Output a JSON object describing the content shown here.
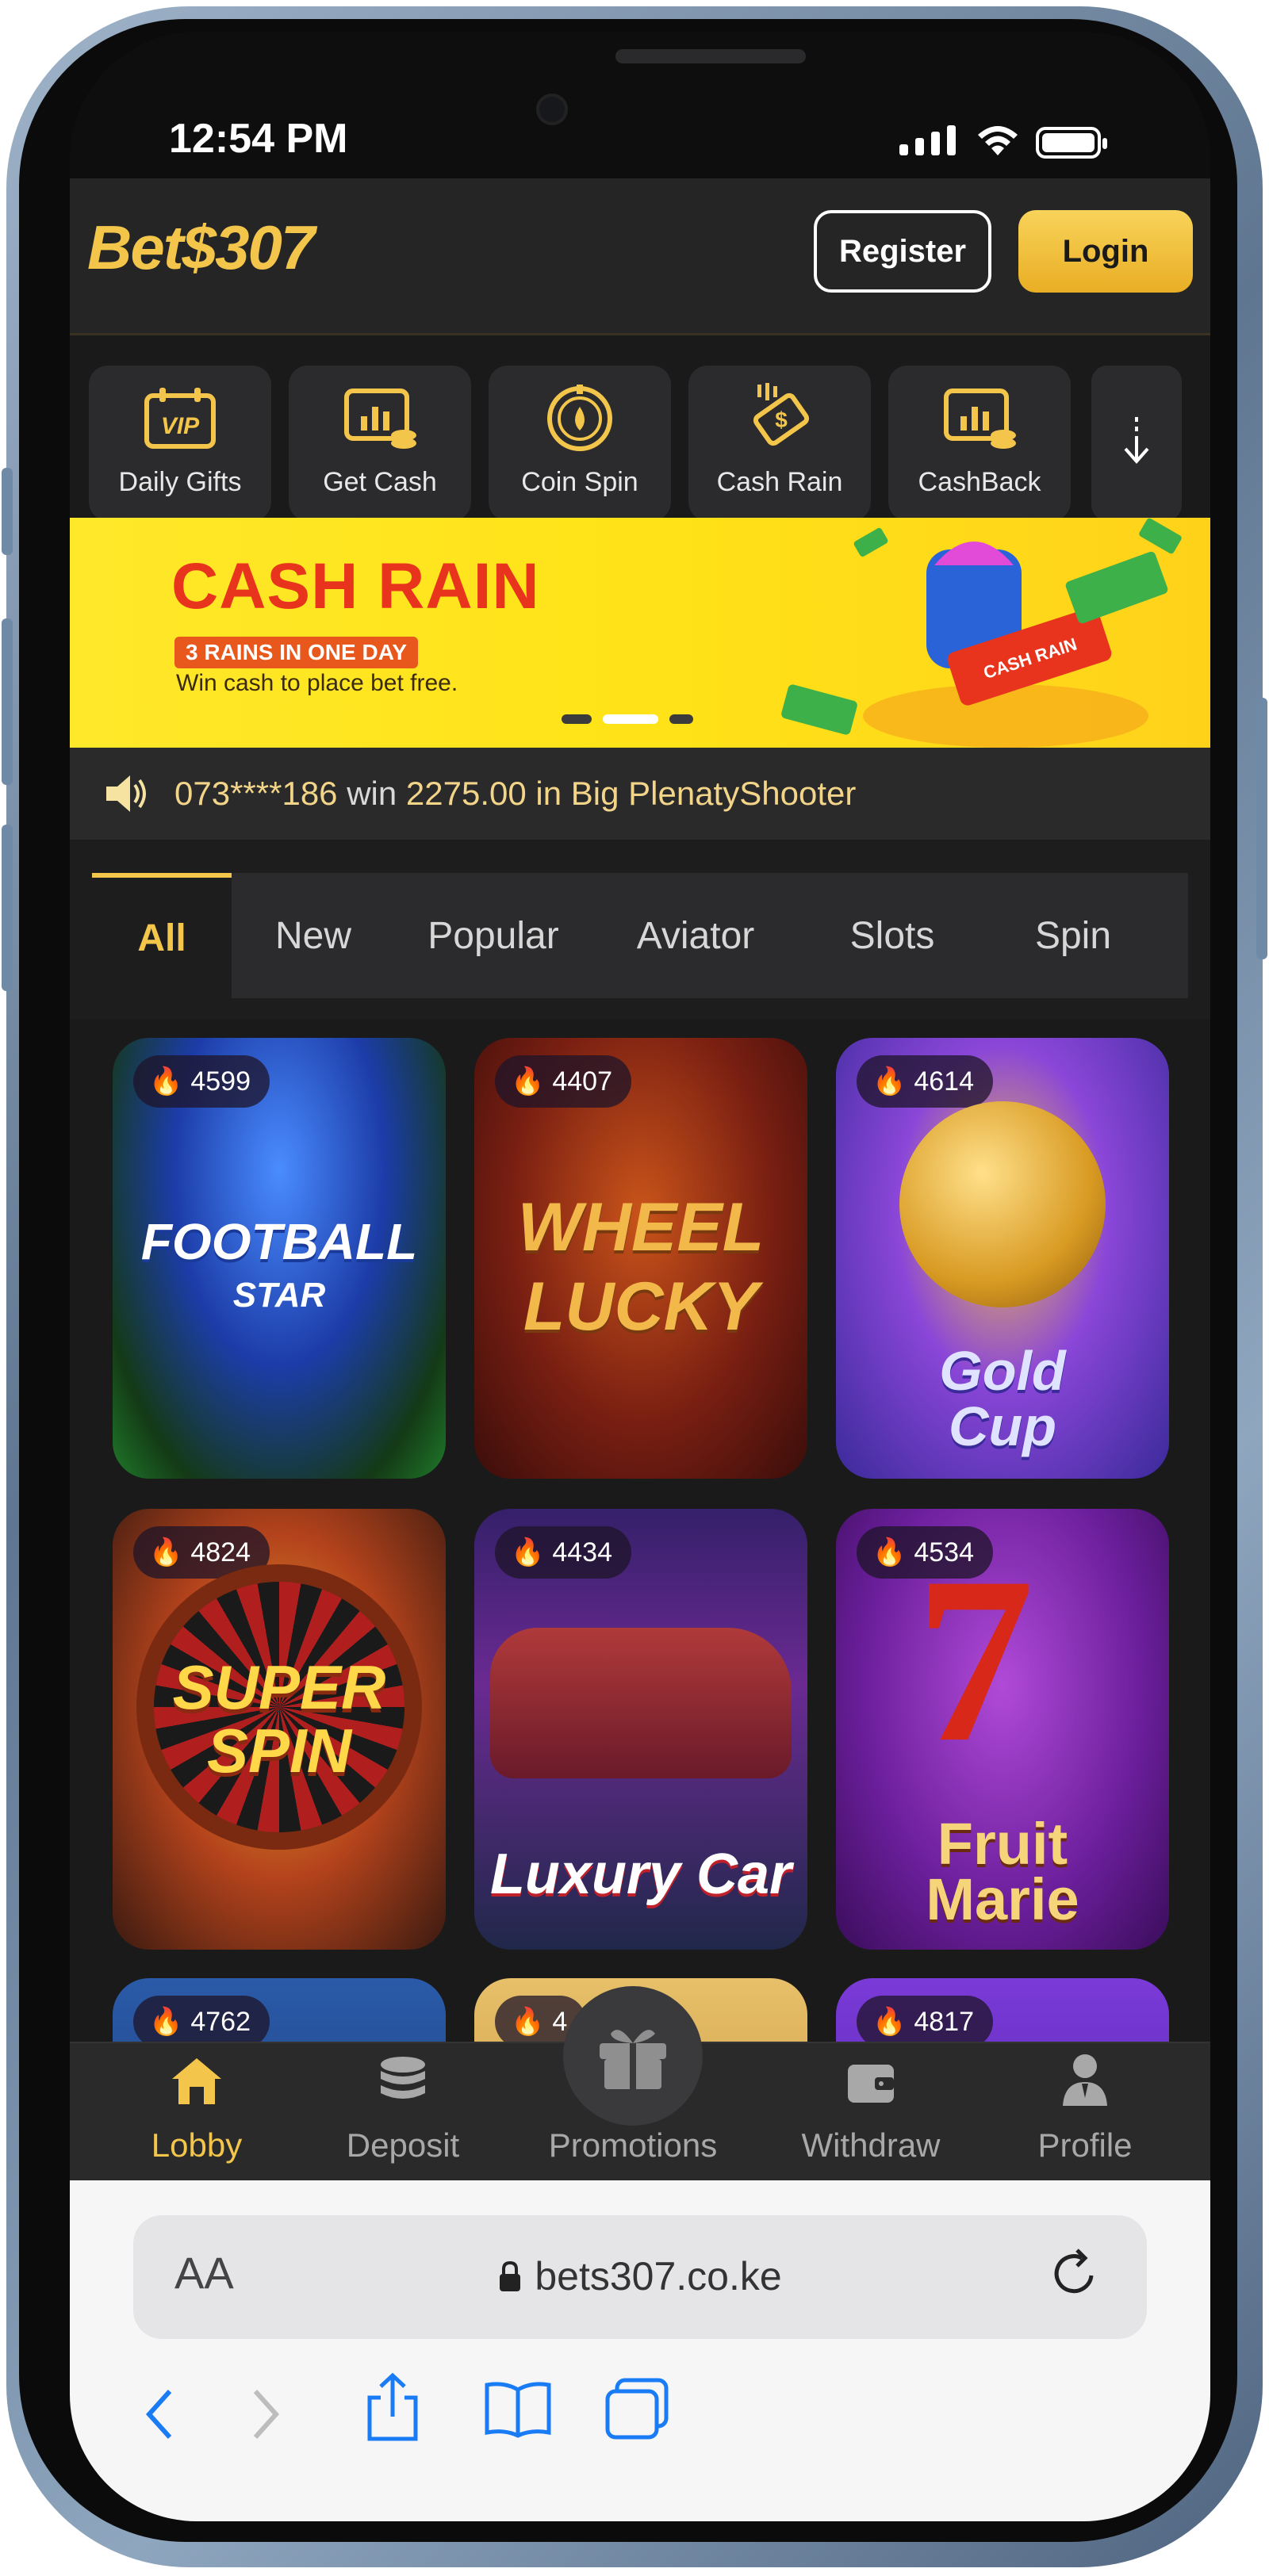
{
  "status_bar": {
    "time": "12:54 PM"
  },
  "header": {
    "logo": "Bet$307",
    "register_label": "Register",
    "login_label": "Login"
  },
  "quick_menu": {
    "items": [
      {
        "label": "Daily Gifts",
        "icon": "vip-calendar-icon"
      },
      {
        "label": "Get Cash",
        "icon": "cash-chart-icon"
      },
      {
        "label": "Coin Spin",
        "icon": "coin-spin-icon"
      },
      {
        "label": "Cash Rain",
        "icon": "cash-rain-icon"
      },
      {
        "label": "CashBack",
        "icon": "cashback-icon"
      }
    ],
    "more_icon": "arrow-down-icon"
  },
  "banner": {
    "title": "CASH RAIN",
    "tag": "3 RAINS IN ONE DAY",
    "subtitle": "Win cash to place bet free.",
    "badge": "CASH RAIN"
  },
  "ticker": {
    "user": "073****186",
    "word": "win",
    "amount": "2275.00",
    "game": "in Big PlenatyShooter"
  },
  "tabs": [
    {
      "label": "All",
      "active": true
    },
    {
      "label": "New"
    },
    {
      "label": "Popular"
    },
    {
      "label": "Aviator"
    },
    {
      "label": "Slots"
    },
    {
      "label": "Spin"
    }
  ],
  "games": [
    {
      "count": "4599",
      "title_line1": "FOOTBALL",
      "title_line2": "STAR"
    },
    {
      "count": "4407",
      "title_line1": "WHEEL",
      "title_line2": "LUCKY"
    },
    {
      "count": "4614",
      "title_line1": "Gold",
      "title_line2": "Cup"
    },
    {
      "count": "4824",
      "title_line1": "SUPER",
      "title_line2": "SPIN"
    },
    {
      "count": "4434",
      "title_line1": "Luxury Car",
      "title_line2": ""
    },
    {
      "count": "4534",
      "title_line1": "Fruit",
      "title_line2": "Marie"
    },
    {
      "count": "4762"
    },
    {
      "count": "4"
    },
    {
      "count": "4817"
    }
  ],
  "bottom_nav": [
    {
      "label": "Lobby",
      "icon": "home-icon",
      "active": true
    },
    {
      "label": "Deposit",
      "icon": "coins-icon"
    },
    {
      "label": "Promotions",
      "icon": "gift-icon"
    },
    {
      "label": "Withdraw",
      "icon": "wallet-icon"
    },
    {
      "label": "Profile",
      "icon": "user-icon"
    }
  ],
  "browser": {
    "aa_label": "AA",
    "url": "bets307.co.ke"
  },
  "colors": {
    "accent": "#f3c64b",
    "background": "#1a1a1b",
    "banner": "#ffe318",
    "browser_blue": "#1a7cf5"
  }
}
